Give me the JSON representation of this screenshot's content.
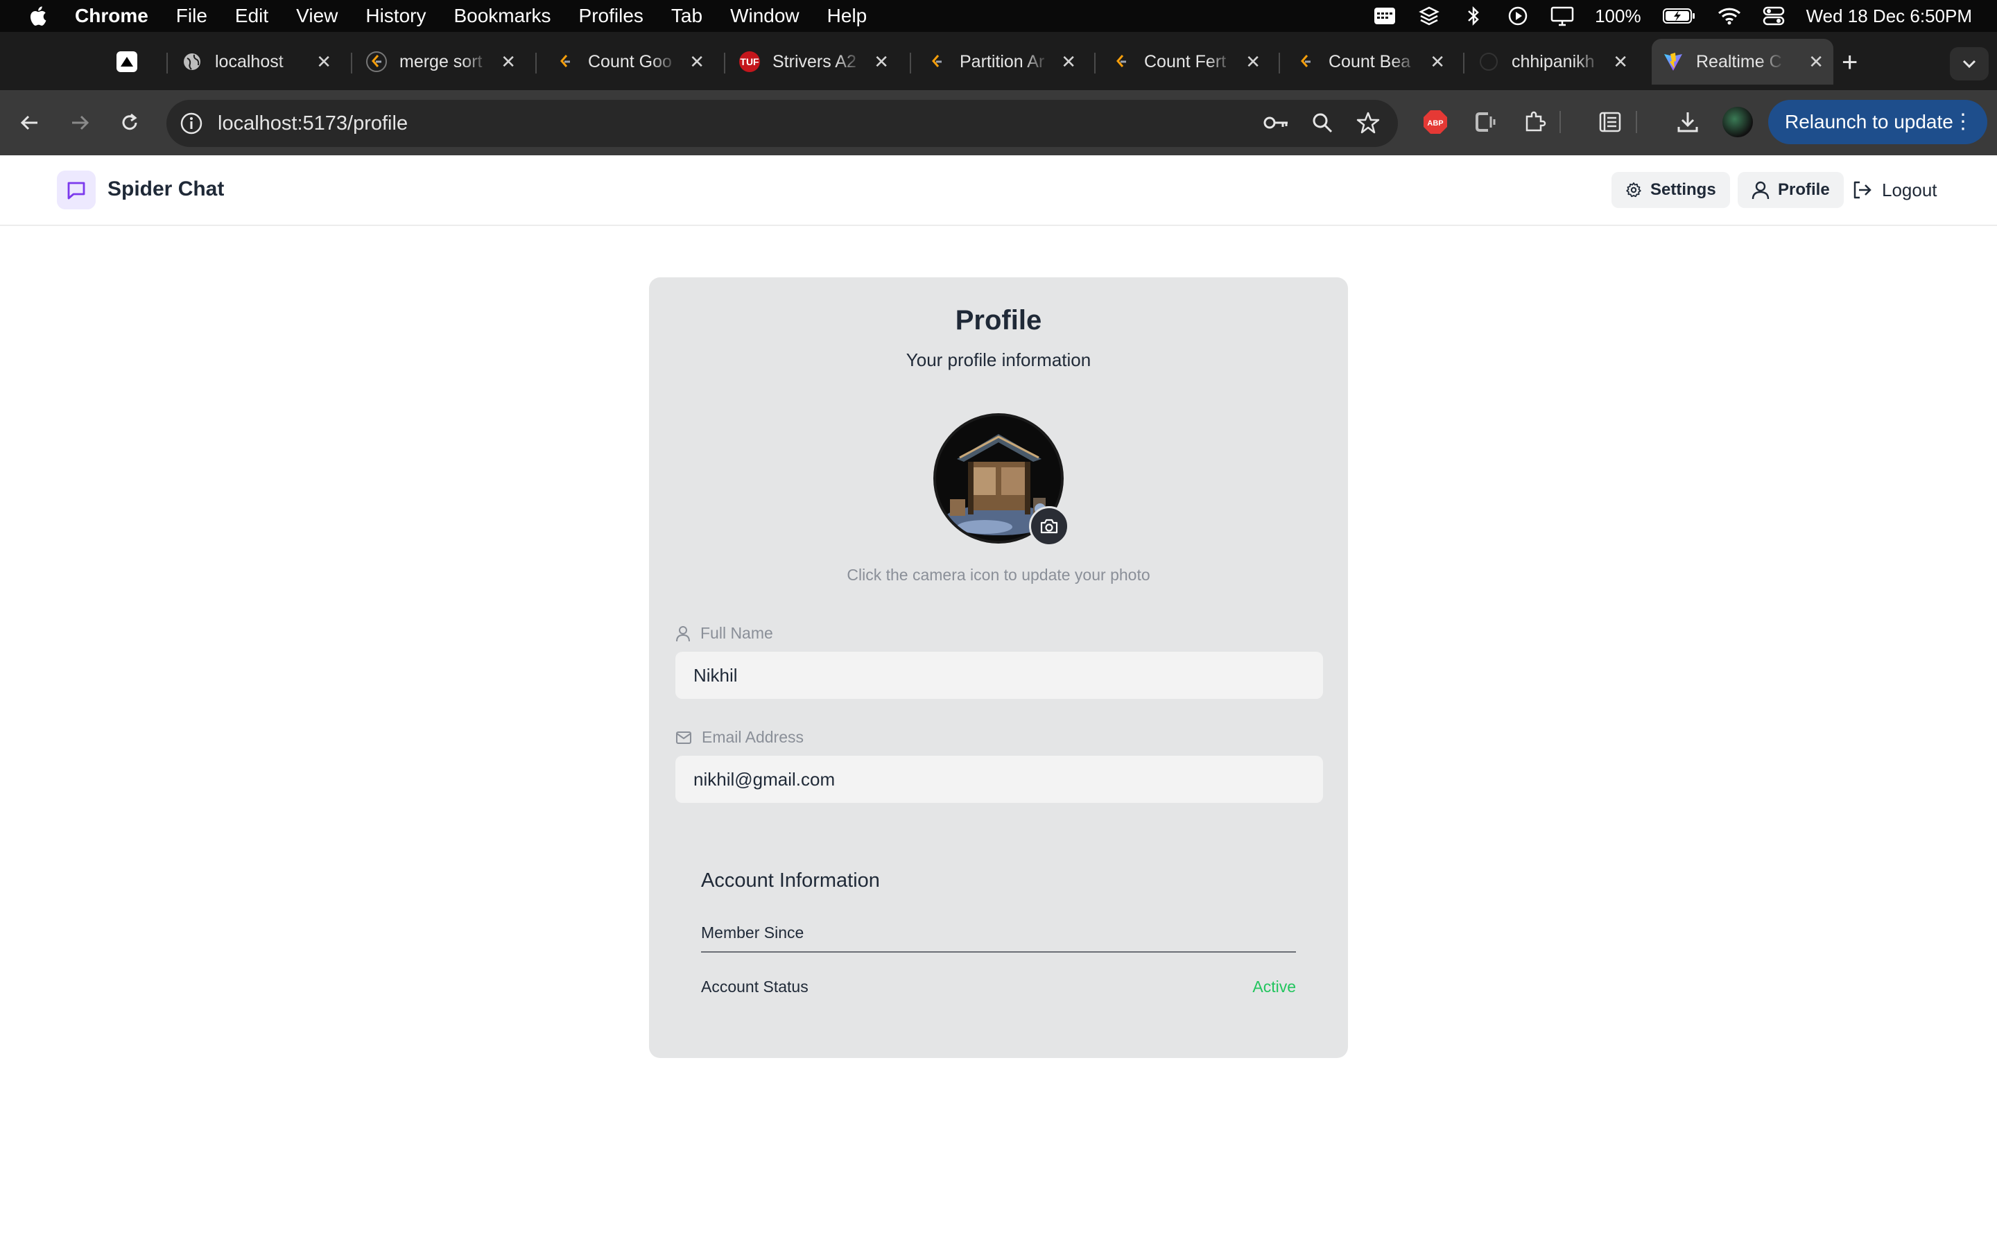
{
  "menubar": {
    "app_name": "Chrome",
    "items": [
      "File",
      "Edit",
      "View",
      "History",
      "Bookmarks",
      "Profiles",
      "Tab",
      "Window",
      "Help"
    ],
    "battery": "100%",
    "clock": "Wed 18 Dec  6:50PM"
  },
  "tabs": [
    {
      "title": "",
      "favicon": "vercel-icon"
    },
    {
      "title": "localhost",
      "favicon": "globe-icon"
    },
    {
      "title": "merge sort",
      "favicon": "leetcode-icon"
    },
    {
      "title": "Count Goo",
      "favicon": "leetcode-icon"
    },
    {
      "title": "Strivers A2",
      "favicon": "tuf-icon",
      "favicon_text": "TUF"
    },
    {
      "title": "Partition Ar",
      "favicon": "leetcode-icon"
    },
    {
      "title": "Count Fert",
      "favicon": "leetcode-icon"
    },
    {
      "title": "Count Bea",
      "favicon": "leetcode-icon"
    },
    {
      "title": "chhipanikh",
      "favicon": "github-icon"
    },
    {
      "title": "Realtime C",
      "favicon": "vite-icon",
      "active": true
    }
  ],
  "toolbar": {
    "url": "localhost:5173/profile",
    "relaunch_label": "Relaunch to update",
    "abp_label": "ABP"
  },
  "app": {
    "brand": "Spider Chat",
    "nav": {
      "settings": "Settings",
      "profile": "Profile",
      "logout": "Logout"
    }
  },
  "profile": {
    "title": "Profile",
    "subtitle": "Your profile information",
    "photo_hint": "Click the camera icon to update your photo",
    "full_name_label": "Full Name",
    "full_name_value": "Nikhil",
    "email_label": "Email Address",
    "email_value": "nikhil@gmail.com",
    "account": {
      "title": "Account Information",
      "member_since_label": "Member Since",
      "member_since_value": "",
      "status_label": "Account Status",
      "status_value": "Active"
    }
  },
  "colors": {
    "accent": "#7c3aed",
    "status_active": "#22c55e",
    "relaunch_bg": "#1e4e8c"
  }
}
